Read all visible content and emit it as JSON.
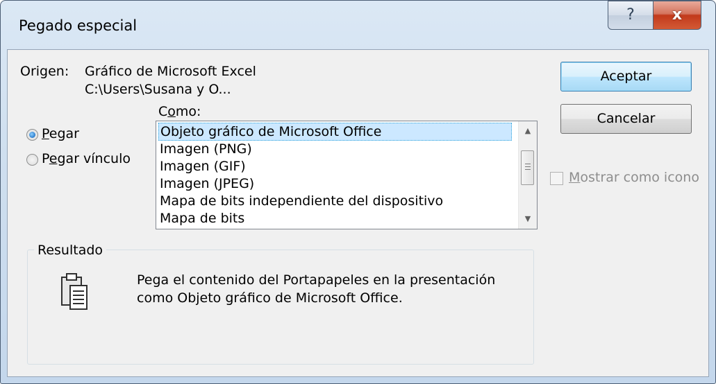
{
  "window": {
    "title": "Pegado especial",
    "help_label": "?",
    "close_label": "x"
  },
  "origin": {
    "label": "Origen:",
    "line1": "Gráfico de Microsoft Excel",
    "line2": "C:\\Users\\Susana y O..."
  },
  "como_label_pre": "C",
  "como_label_u": "o",
  "como_label_post": "mo:",
  "radios": {
    "pegar": {
      "pre": "",
      "u": "P",
      "post": "egar",
      "checked": true
    },
    "vinculo": {
      "pre": "P",
      "u": "e",
      "post": "gar vínculo",
      "checked": false
    }
  },
  "list": {
    "items": [
      "Objeto gráfico de Microsoft Office",
      "Imagen (PNG)",
      "Imagen (GIF)",
      "Imagen (JPEG)",
      "Mapa de bits independiente del dispositivo",
      "Mapa de bits"
    ],
    "selected_index": 0
  },
  "buttons": {
    "ok": "Aceptar",
    "cancel": "Cancelar"
  },
  "show_icon": {
    "u": "M",
    "post": "ostrar como icono",
    "checked": false,
    "enabled": false
  },
  "result": {
    "title": "Resultado",
    "line1": "Pega el contenido del Portapapeles en la presentación",
    "line2": "como Objeto gráfico de Microsoft Office."
  }
}
